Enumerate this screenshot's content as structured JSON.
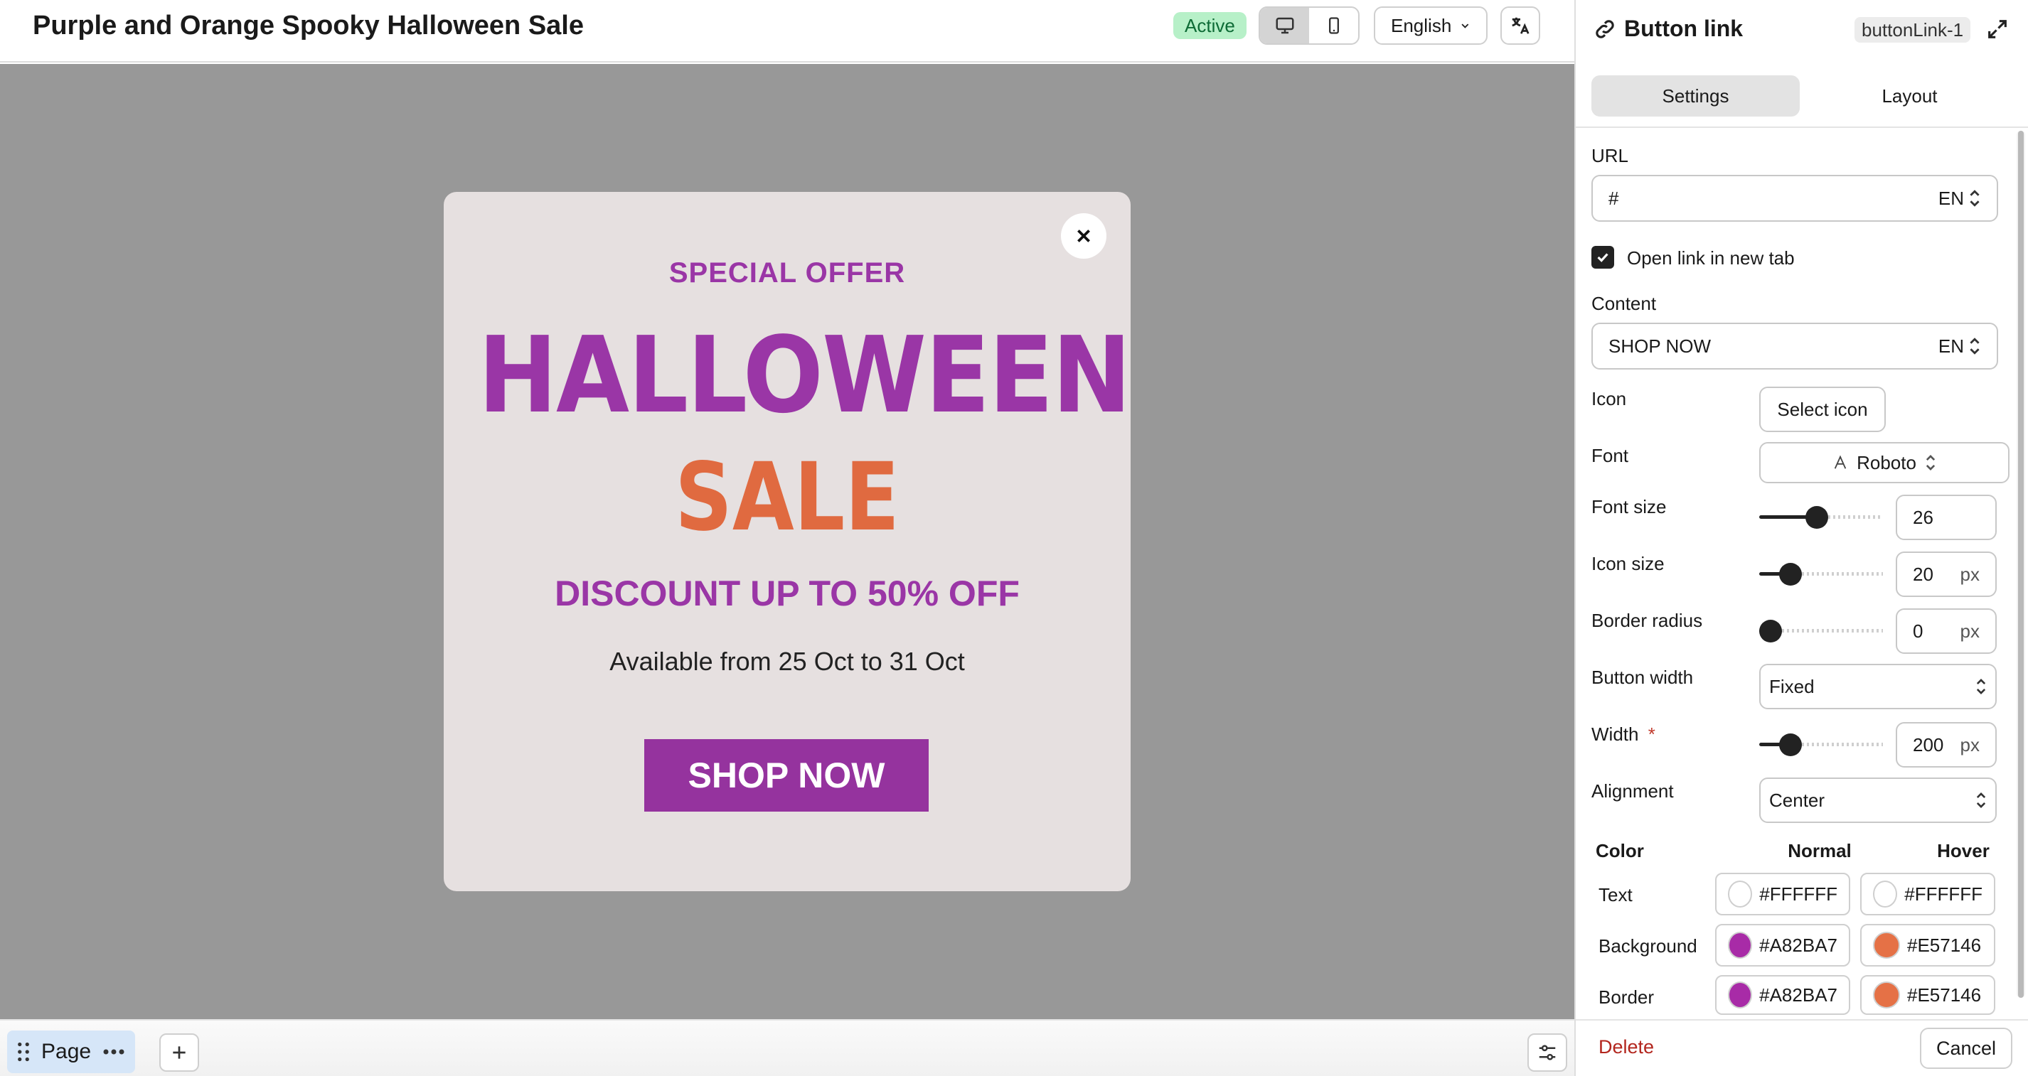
{
  "header": {
    "page_title": "Purple and Orange Spooky Halloween Sale",
    "status": "Active",
    "language": "English"
  },
  "popup": {
    "special_offer": "SPECIAL OFFER",
    "headline": "HALLOWEEN",
    "subheadline": "SALE",
    "discount": "DISCOUNT UP TO 50% OFF",
    "availability": "Available from 25 Oct to 31 Oct",
    "button_label": "SHOP NOW",
    "colors": {
      "purple": "#9A36A6",
      "orange": "#E06A40",
      "background": "#E6E0E0"
    }
  },
  "bottom_bar": {
    "page_label": "Page"
  },
  "panel": {
    "title": "Button link",
    "element_id": "buttonLink-1",
    "tabs": [
      {
        "label": "Settings"
      },
      {
        "label": "Layout"
      }
    ],
    "url": {
      "label": "URL",
      "value": "#",
      "lang": "EN"
    },
    "new_tab": {
      "label": "Open link in new tab",
      "checked": true
    },
    "content": {
      "label": "Content",
      "value": "SHOP NOW",
      "lang": "EN"
    },
    "icon": {
      "label": "Icon",
      "button": "Select icon"
    },
    "font": {
      "label": "Font",
      "value": "Roboto"
    },
    "font_size": {
      "label": "Font size",
      "value": "26",
      "level": 0.46
    },
    "icon_size": {
      "label": "Icon size",
      "value": "20",
      "unit": "px",
      "level": 0.2
    },
    "border_radius": {
      "label": "Border radius",
      "value": "0",
      "unit": "px",
      "level": 0.0
    },
    "button_width": {
      "label": "Button width",
      "value": "Fixed"
    },
    "width": {
      "label": "Width",
      "required": "*",
      "value": "200",
      "unit": "px",
      "level": 0.2
    },
    "alignment": {
      "label": "Alignment",
      "value": "Center"
    },
    "color": {
      "heading": "Color",
      "normal_heading": "Normal",
      "hover_heading": "Hover",
      "rows": [
        {
          "label": "Text",
          "normal": "#FFFFFF",
          "hover": "#FFFFFF"
        },
        {
          "label": "Background",
          "normal": "#A82BA7",
          "hover": "#E57146"
        },
        {
          "label": "Border",
          "normal": "#A82BA7",
          "hover": "#E57146"
        }
      ]
    },
    "footer": {
      "delete": "Delete",
      "cancel": "Cancel"
    }
  }
}
